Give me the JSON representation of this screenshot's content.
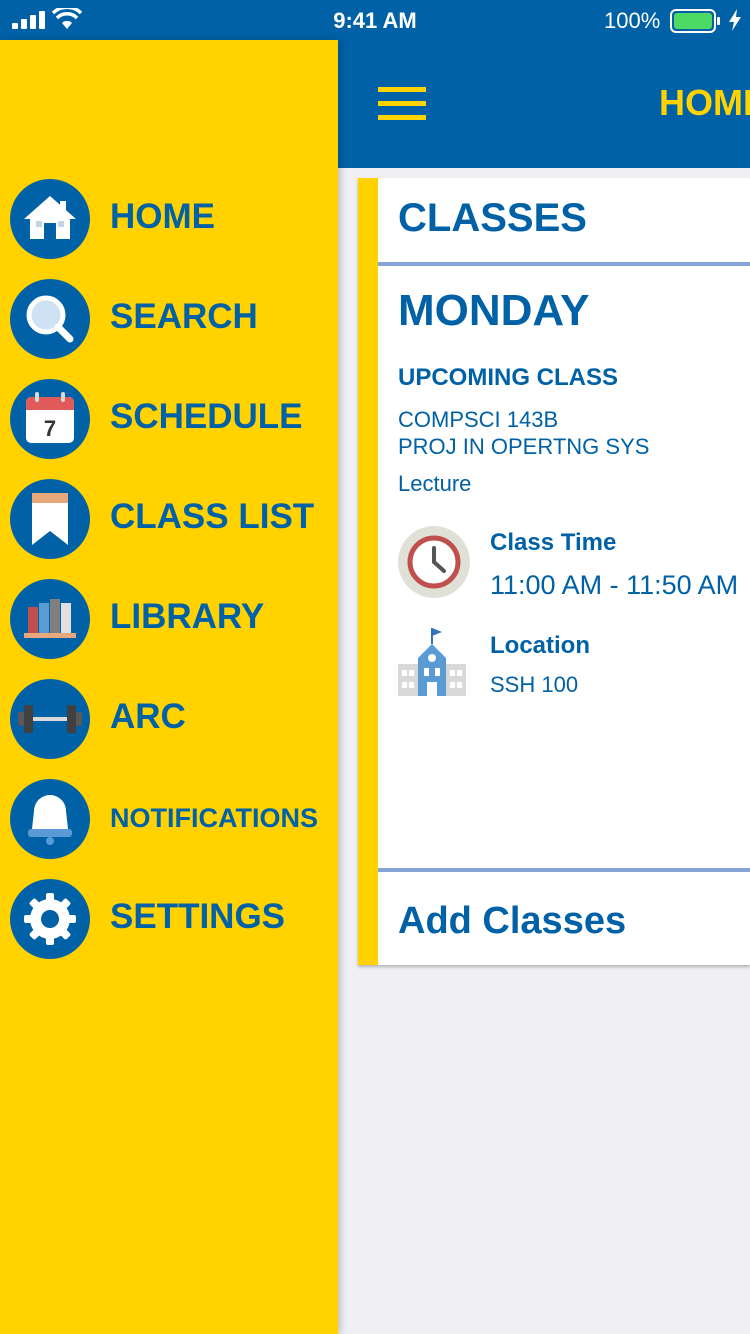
{
  "status_bar": {
    "time": "9:41 AM",
    "battery_percent": "100%"
  },
  "header": {
    "title": "HOME",
    "menu_icon": "hamburger-icon"
  },
  "colors": {
    "brand_blue": "#0061a6",
    "brand_gold": "#ffd200",
    "divider": "#87a4d6",
    "background": "#efeff4"
  },
  "drawer": {
    "items": [
      {
        "label": "HOME",
        "icon": "home-icon"
      },
      {
        "label": "SEARCH",
        "icon": "search-icon"
      },
      {
        "label": "SCHEDULE",
        "icon": "calendar-icon",
        "icon_text": "7"
      },
      {
        "label": "CLASS LIST",
        "icon": "bookmark-icon"
      },
      {
        "label": "LIBRARY",
        "icon": "books-icon"
      },
      {
        "label": "ARC",
        "icon": "dumbbell-icon"
      },
      {
        "label": "NOTIFICATIONS",
        "icon": "bell-icon"
      },
      {
        "label": "SETTINGS",
        "icon": "gear-icon"
      }
    ]
  },
  "classes_card": {
    "title": "CLASSES",
    "day": "MONDAY",
    "upcoming_label": "UPCOMING CLASS",
    "course_code": "COMPSCI 143B",
    "course_name": "PROJ IN OPERTNG SYS",
    "course_type": "Lecture",
    "time_label": "Class Time",
    "time_value": "11:00 AM - 11:50 AM",
    "location_label": "Location",
    "location_value": "SSH 100",
    "add_button": "Add Classes"
  }
}
